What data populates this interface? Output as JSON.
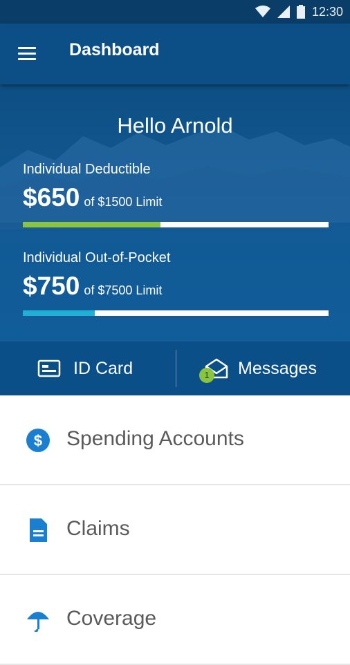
{
  "status_bar": {
    "time": "12:30"
  },
  "app_bar": {
    "title": "Dashboard"
  },
  "hero": {
    "greeting": "Hello Arnold",
    "deductible": {
      "label": "Individual Deductible",
      "amount": "$650",
      "limit_text": "of $1500 Limit",
      "progress": 0.45,
      "color": "#8bc53f"
    },
    "out_of_pocket": {
      "label": "Individual Out-of-Pocket",
      "amount": "$750",
      "limit_text": "of $7500 Limit",
      "progress": 0.235,
      "color": "#1fb0d6"
    }
  },
  "quick_actions": {
    "id_card_label": "ID Card",
    "messages_label": "Messages",
    "messages_badge": "1"
  },
  "list_items": [
    {
      "label": "Spending Accounts",
      "icon": "dollar-icon"
    },
    {
      "label": "Claims",
      "icon": "document-icon"
    },
    {
      "label": "Coverage",
      "icon": "umbrella-icon"
    }
  ],
  "colors": {
    "primary": "#0c4f86",
    "status_bar": "#0b3d69",
    "icon_blue": "#1a7fd0",
    "badge_green": "#8bc53f"
  }
}
